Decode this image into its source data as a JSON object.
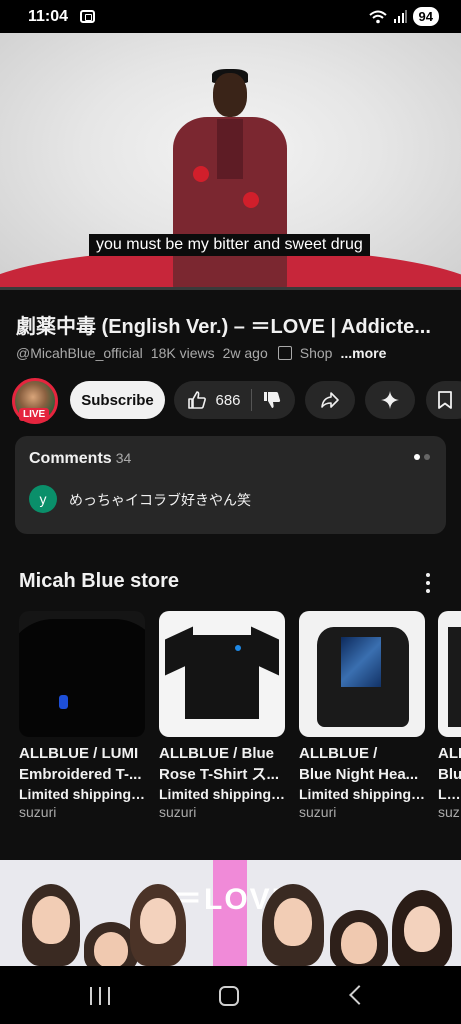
{
  "status_bar": {
    "time": "11:04",
    "battery": "94"
  },
  "video": {
    "caption": "you must be my bitter and sweet drug"
  },
  "video_info": {
    "title": "劇薬中毒 (English Ver.) – ＝LOVE | Addicte...",
    "channel_handle": "@MicahBlue_official",
    "views": "18K views",
    "age": "2w ago",
    "shop_label": "Shop",
    "more_label": "...more"
  },
  "actions": {
    "live_badge": "LIVE",
    "subscribe_label": "Subscribe",
    "like_count": "686"
  },
  "comments": {
    "heading": "Comments",
    "count": "34",
    "avatar_letter": "y",
    "top_comment": "めっちゃイコラブ好きやん笑"
  },
  "store": {
    "title": "Micah Blue store",
    "products": [
      {
        "name_line1": "ALLBLUE / LUMI",
        "name_line2": "Embroidered T-...",
        "shipping": "Limited shipping ...",
        "seller": "suzuri"
      },
      {
        "name_line1": "ALLBLUE / Blue",
        "name_line2": "Rose T-Shirt ス...",
        "shipping": "Limited shipping ...",
        "seller": "suzuri"
      },
      {
        "name_line1": "ALLBLUE /",
        "name_line2": "Blue Night Hea...",
        "shipping": "Limited shipping ...",
        "seller": "suzuri"
      },
      {
        "name_line1": "ALL",
        "name_line2": "Blu",
        "shipping": "Lim",
        "seller": "suz"
      }
    ]
  },
  "banner": {
    "logo_text": "＝LOVE"
  },
  "colors": {
    "background": "#0f0f0f",
    "surface": "#272727",
    "live_red": "#e5253e",
    "subscribe_bg": "#f1f1f1"
  },
  "icons": {
    "like": "thumbs-up-icon",
    "dislike": "thumbs-down-icon",
    "share": "share-icon",
    "remix": "sparkle-icon",
    "save": "bookmark-icon",
    "shop": "shopping-bag-icon"
  }
}
